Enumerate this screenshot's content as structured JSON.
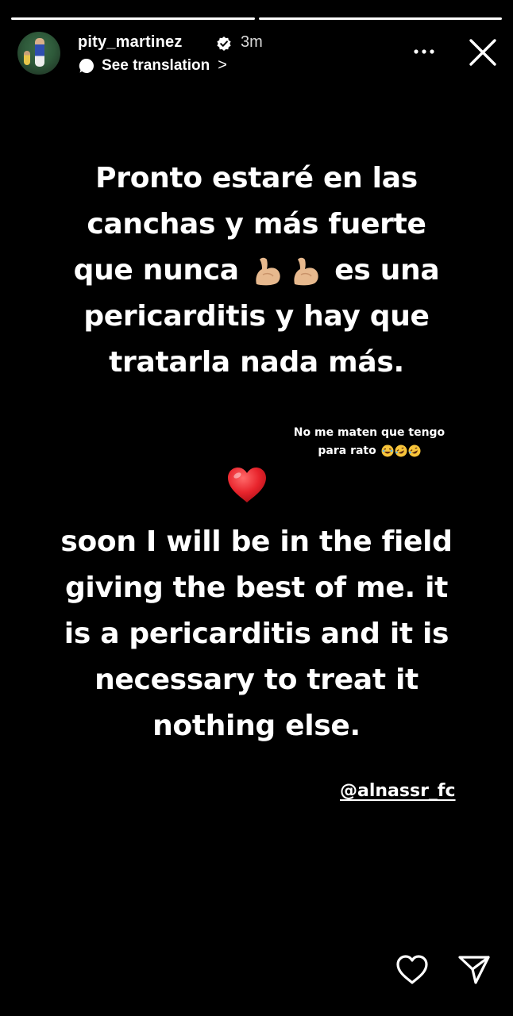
{
  "story": {
    "progress": [
      1.0,
      1.0
    ],
    "username": "pity_martinez",
    "verified": true,
    "time": "3m",
    "translation_label": "See translation",
    "translation_chevron": ">"
  },
  "content": {
    "spanish_lines": [
      "Pronto estaré en las",
      "canchas y más fuerte",
      "que nunca",
      "es una",
      "pericarditis y hay que",
      "tratarla nada más."
    ],
    "note_lines": [
      "No me maten que tengo",
      "para rato"
    ],
    "english_lines": [
      "soon I will be in the field",
      "giving the best of me.  it",
      "is a pericarditis and it is",
      "necessary to treat it",
      "nothing else."
    ],
    "mention": "@alnassr_fc"
  },
  "icons": {
    "verified": "verified-badge-icon",
    "translate": "speech-bubble-icon",
    "more": "more-horizontal-icon",
    "close": "close-icon",
    "muscle": "flexed-biceps-emoji",
    "laugh": "laughing-emoji",
    "rofl": "rolling-laughing-emoji",
    "heart": "red-heart-emoji",
    "like": "heart-outline-icon",
    "share": "paper-plane-icon"
  },
  "colors": {
    "background": "#000000",
    "text": "#ffffff",
    "heart": "#e8242c",
    "muscle": "#e7b98e"
  }
}
